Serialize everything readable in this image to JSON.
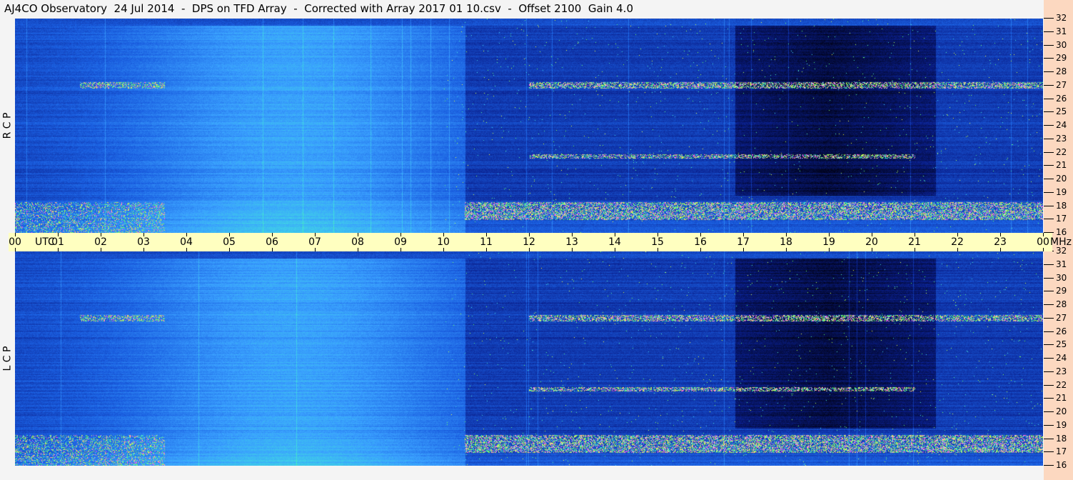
{
  "title": "AJ4CO Observatory  24 Jul 2014  -  DPS on TFD Array  -  Corrected with Array 2017 01 10.csv  -  Offset 2100  Gain 4.0",
  "chart_data": {
    "type": "heatmap",
    "panels": [
      {
        "label": "R C P",
        "ylim": [
          16,
          32
        ]
      },
      {
        "label": "L C P",
        "ylim": [
          16,
          32
        ]
      }
    ],
    "x_ticks": [
      "00",
      "01",
      "02",
      "03",
      "04",
      "05",
      "06",
      "07",
      "08",
      "09",
      "10",
      "11",
      "12",
      "13",
      "14",
      "15",
      "16",
      "17",
      "18",
      "19",
      "20",
      "21",
      "22",
      "23",
      "00"
    ],
    "x_unit": "UTC",
    "y_ticks": [
      "16",
      "17",
      "18",
      "19",
      "20",
      "21",
      "22",
      "23",
      "24",
      "25",
      "26",
      "27",
      "28",
      "29",
      "30",
      "31",
      "32"
    ],
    "y_unit": "MHz",
    "xlim": [
      0,
      24
    ],
    "colormap": [
      "#000010",
      "#0a1f8c",
      "#1a5ee0",
      "#3aa0ff",
      "#40e0e0",
      "#60ff60",
      "#ffff40",
      "#ff40ff",
      "#ffffff"
    ],
    "features": [
      {
        "desc_freq_MHz": [
          17,
          18.3
        ],
        "hours": [
          10.5,
          24
        ]
      },
      {
        "desc_freq_MHz": [
          26.8,
          27.3
        ],
        "hours": [
          12,
          24
        ]
      },
      {
        "desc_freq_MHz": [
          21.6,
          21.9
        ],
        "hours": [
          12,
          21
        ]
      }
    ]
  },
  "colors": {
    "time_axis_bg": "#ffffc0",
    "freq_axis_bg": "#fcd8c0"
  }
}
